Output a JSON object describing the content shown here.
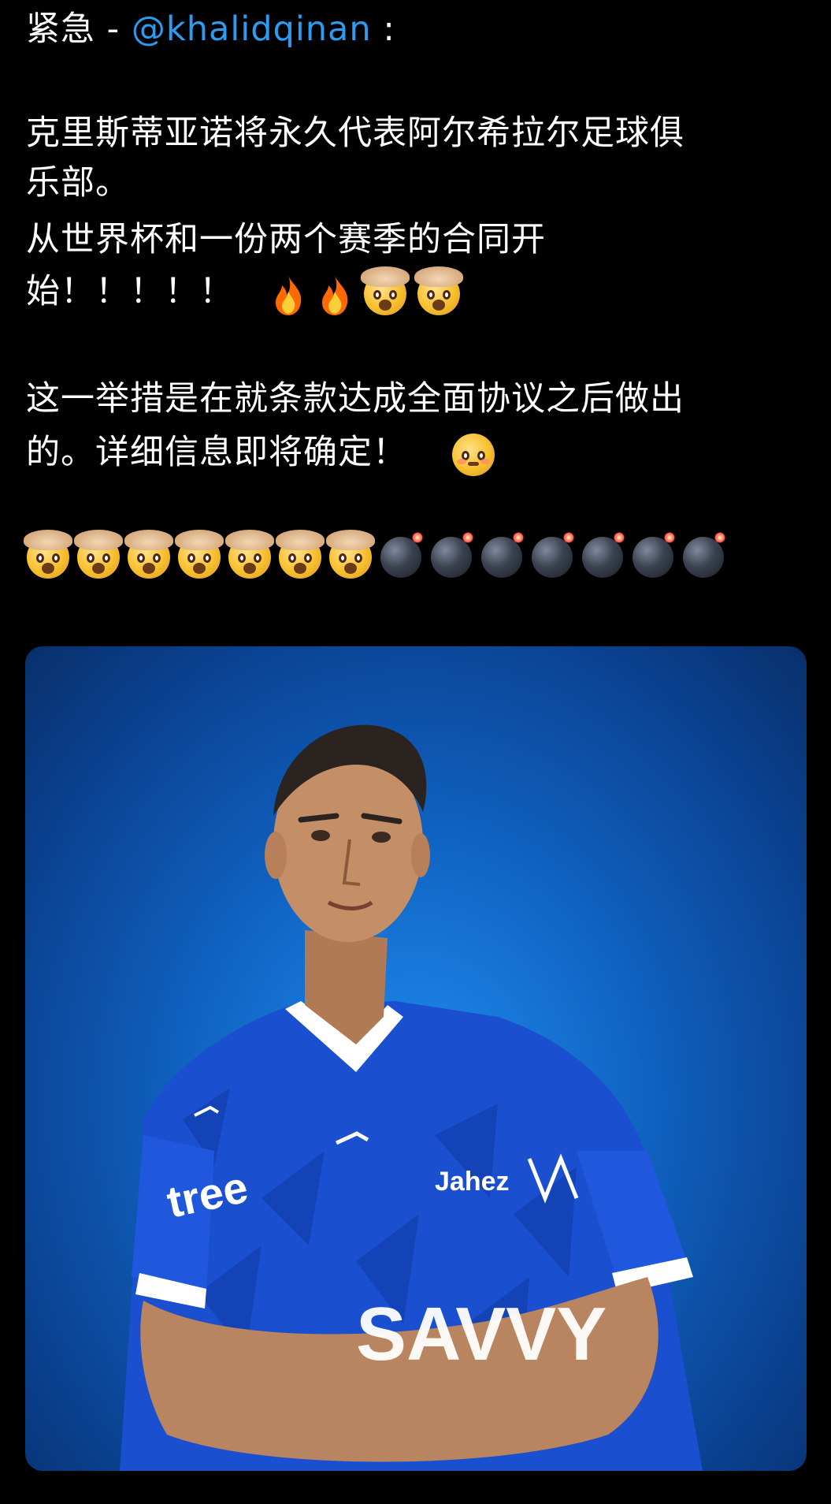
{
  "post": {
    "header_prefix": "紧急 - ",
    "mention": "@khalidqinan",
    "header_suffix": " :",
    "line1": "克里斯蒂亚诺将永久代表阿尔希拉尔足球俱",
    "line2": "乐部。",
    "line3": "从世界杯和一份两个赛季的合同开",
    "line4": "始！！！！！",
    "line5": "这一举措是在就条款达成全面协议之后做出",
    "line6": "的。详细信息即将确定！",
    "emoji_row": {
      "exploding_head_count": 7,
      "bomb_count": 7
    }
  },
  "image": {
    "jersey_text_left": "tree",
    "jersey_text_chest": "Jahez",
    "jersey_text_bottom": "SAVVY"
  },
  "colors": {
    "background": "#000000",
    "mention": "#2d9bf0",
    "photo_blue": "#1f8df0"
  }
}
